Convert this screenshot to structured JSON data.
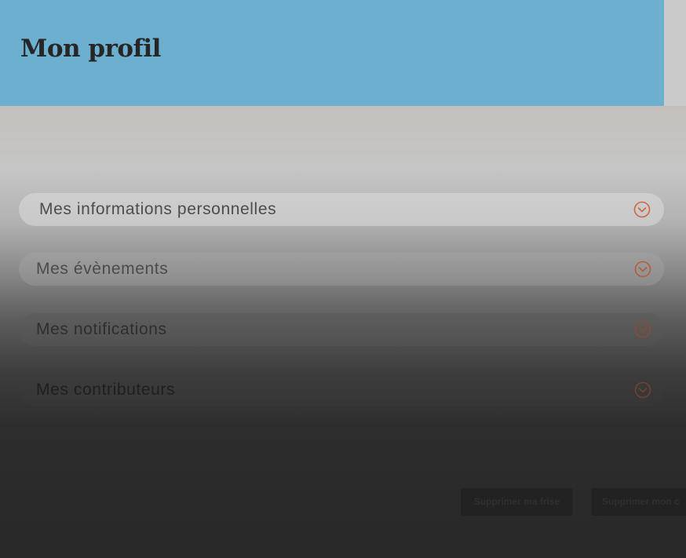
{
  "header": {
    "title": "Mon profil",
    "background_color": "#6cafce"
  },
  "accordion": {
    "items": [
      {
        "label": "Mes informations personnelles",
        "icon": "chevron-down-circle-icon"
      },
      {
        "label": "Mes évènements",
        "icon": "chevron-down-circle-icon"
      },
      {
        "label": "Mes notifications",
        "icon": "chevron-down-circle-icon"
      },
      {
        "label": "Mes contributeurs",
        "icon": "chevron-down-circle-icon"
      }
    ],
    "icon_color": "#d0653f"
  },
  "actions": {
    "delete_frise_label": "Supprimer ma frise",
    "delete_account_label": "Supprimer mon c"
  }
}
